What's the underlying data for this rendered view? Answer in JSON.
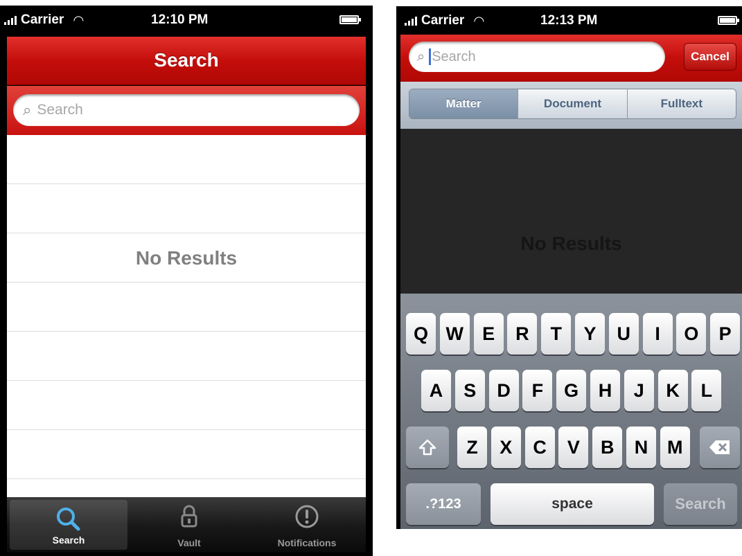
{
  "phone1": {
    "status": {
      "carrier": "Carrier",
      "time": "12:10 PM"
    },
    "nav_title": "Search",
    "search_placeholder": "Search",
    "no_results": "No Results",
    "tabs": [
      {
        "label": "Search",
        "icon": "search-icon",
        "active": true
      },
      {
        "label": "Vault",
        "icon": "lock-icon",
        "active": false
      },
      {
        "label": "Notifications",
        "icon": "exclamation-icon",
        "active": false
      }
    ]
  },
  "phone2": {
    "status": {
      "carrier": "Carrier",
      "time": "12:13 PM"
    },
    "search_placeholder": "Search",
    "cancel_label": "Cancel",
    "scopes": [
      {
        "label": "Matter",
        "selected": true
      },
      {
        "label": "Document",
        "selected": false
      },
      {
        "label": "Fulltext",
        "selected": false
      }
    ],
    "no_results": "No Results",
    "keyboard": {
      "row1": [
        "Q",
        "W",
        "E",
        "R",
        "T",
        "Y",
        "U",
        "I",
        "O",
        "P"
      ],
      "row2": [
        "A",
        "S",
        "D",
        "F",
        "G",
        "H",
        "J",
        "K",
        "L"
      ],
      "row3": [
        "Z",
        "X",
        "C",
        "V",
        "B",
        "N",
        "M"
      ],
      "numbers_key": ".?123",
      "space_key": "space",
      "search_key": "Search"
    }
  },
  "colors": {
    "nav_red": "#c40e0b",
    "scope_blue": "#4d6580"
  }
}
